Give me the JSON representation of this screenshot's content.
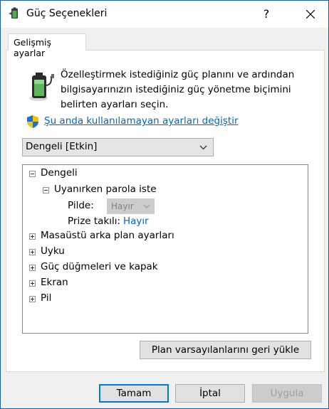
{
  "window": {
    "title": "Güç Seçenekleri",
    "help_label": "?"
  },
  "tab": {
    "label": "Gelişmiş ayarlar"
  },
  "panel": {
    "description": "Özelleştirmek istediğiniz güç planını ve ardından bilgisayarınızın istediğiniz güç yönetme biçimini belirten ayarları seçin.",
    "change_settings_link": "Şu anda kullanılamayan ayarları değiştir",
    "plan_select": {
      "value": "Dengeli [Etkin]"
    }
  },
  "tree": {
    "root": {
      "label": "Dengeli",
      "expanded": true
    },
    "group": {
      "label": "Uyanırken parola iste",
      "expanded": true
    },
    "on_battery": {
      "label": "Pilde:",
      "value": "Hayır"
    },
    "plugged_in": {
      "label": "Prize takılı:",
      "value": "Hayır"
    },
    "items": [
      {
        "label": "Masaüstü arka plan ayarları"
      },
      {
        "label": "Uyku"
      },
      {
        "label": "Güç düğmeleri ve kapak"
      },
      {
        "label": "Ekran"
      },
      {
        "label": "Pil"
      }
    ]
  },
  "restore_button": "Plan varsayılanlarını geri yükle",
  "footer": {
    "ok": "Tamam",
    "cancel": "İptal",
    "apply": "Uygula"
  },
  "colors": {
    "link": "#0066cc",
    "accent": "#0078d7",
    "window_border": "#1a5ea8"
  }
}
